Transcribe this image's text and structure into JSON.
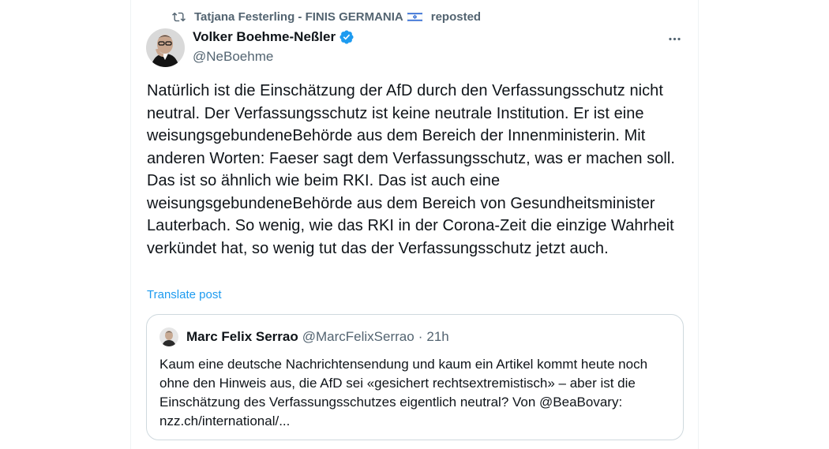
{
  "repost": {
    "icon": "repost-icon",
    "user": "Tatjana Festerling - FINIS GERMANIA",
    "flag": "israel-flag-icon",
    "label": "reposted"
  },
  "author": {
    "name": "Volker Boehme-Neßler",
    "verified": true,
    "handle": "@NeBoehme"
  },
  "post": {
    "text": "Natürlich ist die Einschätzung der AfD durch den Verfassungsschutz nicht neutral. Der Verfassungsschutz ist keine neutrale Institution. Er ist eine weisungsgebundeneBehörde aus dem Bereich der Innenministerin. Mit anderen Worten: Faeser sagt dem Verfassungsschutz, was er machen soll. Das ist so ähnlich wie beim RKI. Das ist auch eine weisungsgebundeneBehörde aus dem Bereich von Gesundheitsminister Lauterbach. So wenig, wie das RKI in der Corona-Zeit die einzige Wahrheit verkündet hat, so wenig tut das der Verfassungsschutz jetzt auch.",
    "translate_label": "Translate post"
  },
  "quote": {
    "name": "Marc Felix Serrao",
    "handle": "@MarcFelixSerrao",
    "separator": "·",
    "time": "21h",
    "text": "Kaum eine deutsche Nachrichtensendung und kaum ein Artikel kommt heute noch ohne den Hinweis aus, die AfD sei «gesichert rechtsextremistisch» – aber ist die Einschätzung des Verfassungsschutzes eigentlich neutral? Von @BeaBovary:  nzz.ch/international/..."
  },
  "colors": {
    "text": "#0f1419",
    "secondary": "#536471",
    "accent": "#1d9bf0",
    "border": "#cfd9de"
  }
}
